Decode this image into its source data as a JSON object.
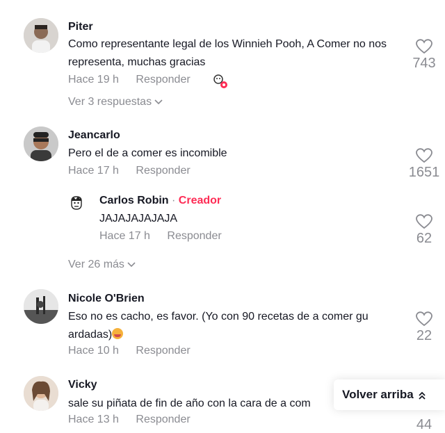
{
  "comments": [
    {
      "name": "Piter",
      "text": "Como representante legal de los Winnieh Pooh, A Comer no nos representa, muchas gracias",
      "time": "Hace 19 h",
      "reply": "Responder",
      "likes": "743",
      "more": "Ver 3 respuestas"
    },
    {
      "name": "Jeancarlo",
      "text": "Pero el de a comer es incomible",
      "time": "Hace 17 h",
      "reply": "Responder",
      "likes": "1651",
      "more": "Ver 26 más"
    },
    {
      "name": "Nicole O'Brien",
      "text": "Eso no es cacho, es favor. (Yo con 90 recetas de a comer gu ardadas)",
      "time": "Hace 10 h",
      "reply": "Responder",
      "likes": "22"
    },
    {
      "name": "Vicky",
      "text": "sale su piñata de fin de año con la cara de a com",
      "time": "Hace 13 h",
      "reply": "Responder",
      "likes": "44"
    }
  ],
  "reply": {
    "name": "Carlos Robin",
    "separator": " · ",
    "badge": "Creador",
    "text": "JAJAJAJAJAJA",
    "time": "Hace 17 h",
    "reply": "Responder",
    "likes": "62"
  },
  "back_to_top": "Volver arriba",
  "colors": {
    "accent": "#fe2c55",
    "muted": "#8a8b91",
    "text": "#161823"
  },
  "icons": [
    "heart-outline-icon",
    "chevron-down-icon",
    "chevron-double-up-icon",
    "sticker-icon",
    "emoji-icon"
  ]
}
